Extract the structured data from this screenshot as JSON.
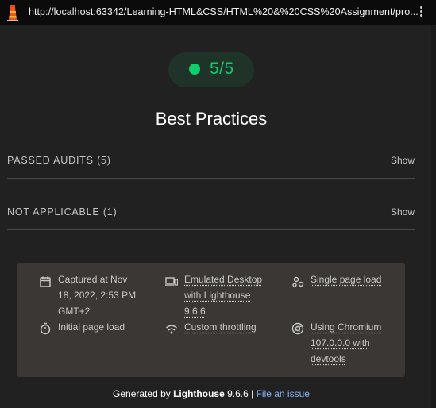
{
  "browser": {
    "url": "http://localhost:63342/Learning-HTML&CSS/HTML%20&%20CSS%20Assignment/pro..."
  },
  "score": {
    "value": "5/5",
    "color": "#0cce6b"
  },
  "category": {
    "title": "Best Practices"
  },
  "groups": [
    {
      "label": "PASSED AUDITS (5)",
      "action": "Show"
    },
    {
      "label": "NOT APPLICABLE (1)",
      "action": "Show"
    }
  ],
  "meta": {
    "captured": "Captured at Nov 18, 2022, 2:53 PM GMT+2",
    "captured_lines": [
      "Captured at Nov",
      "18, 2022, 2:53 PM",
      "GMT+2"
    ],
    "emulated_lines": [
      "Emulated Desktop",
      "with Lighthouse",
      "9.6.6"
    ],
    "single_page": "Single page load",
    "initial_load": "Initial page load",
    "throttling": "Custom throttling",
    "chromium_lines": [
      "Using Chromium",
      "107.0.0.0 with",
      "devtools"
    ]
  },
  "footer": {
    "prefix": "Generated by ",
    "product": "Lighthouse",
    "version": " 9.6.6 | ",
    "issue_link": "File an issue"
  }
}
